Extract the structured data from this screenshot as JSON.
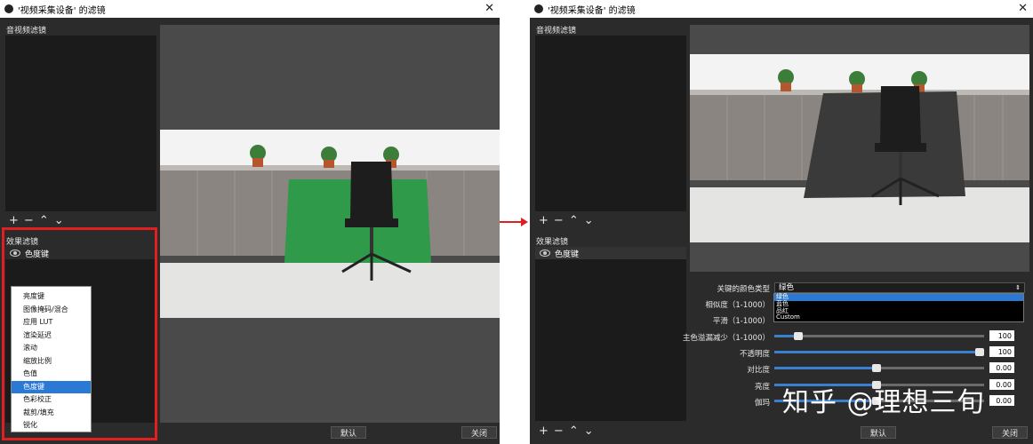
{
  "left_window": {
    "title": "'视频采集设备' 的滤镜",
    "av_filters_header": "音视频滤镜",
    "effect_filters_header": "效果滤镜",
    "effect_items": [
      {
        "label": "色度键"
      }
    ],
    "toolbar": {
      "add": "+",
      "remove": "−",
      "up": "⌃",
      "down": "⌄"
    },
    "buttons": {
      "default": "默认",
      "close": "关闭"
    },
    "context_menu": {
      "items": [
        "亮度键",
        "图像掩码/混合",
        "应用 LUT",
        "渲染延迟",
        "滚动",
        "缩放比例",
        "色值",
        "色度键",
        "色彩校正",
        "裁剪/填充",
        "锐化"
      ],
      "selected": "色度键"
    }
  },
  "right_window": {
    "title": "'视频采集设备' 的滤镜",
    "av_filters_header": "音视频滤镜",
    "effect_filters_header": "效果滤镜",
    "effect_items": [
      {
        "label": "色度键"
      }
    ],
    "toolbar": {
      "add": "+",
      "remove": "−",
      "up": "⌃",
      "down": "⌄"
    },
    "buttons": {
      "default": "默认",
      "close": "关闭"
    },
    "properties": {
      "key_color_type_label": "关键的颜色类型",
      "key_color_type_value": "绿色",
      "dropdown_options": [
        "绿色",
        "蓝色",
        "品红",
        "Custom"
      ],
      "similarity_label": "相似度（1-1000）",
      "smoothness_label": "平滑（1-1000）",
      "spill_label": "主色溢漏减少（1-1000）",
      "spill_value": "100",
      "opacity_label": "不透明度",
      "opacity_value": "100",
      "contrast_label": "对比度",
      "contrast_value": "0.00",
      "brightness_label": "亮度",
      "brightness_value": "0.00",
      "gamma_label": "伽玛",
      "gamma_value": "0.00"
    }
  },
  "watermark": "知乎 @理想三旬",
  "colors": {
    "highlight_red": "#e02020",
    "selection_blue": "#2a7ad5",
    "green_screen": "#2f9a4a"
  }
}
